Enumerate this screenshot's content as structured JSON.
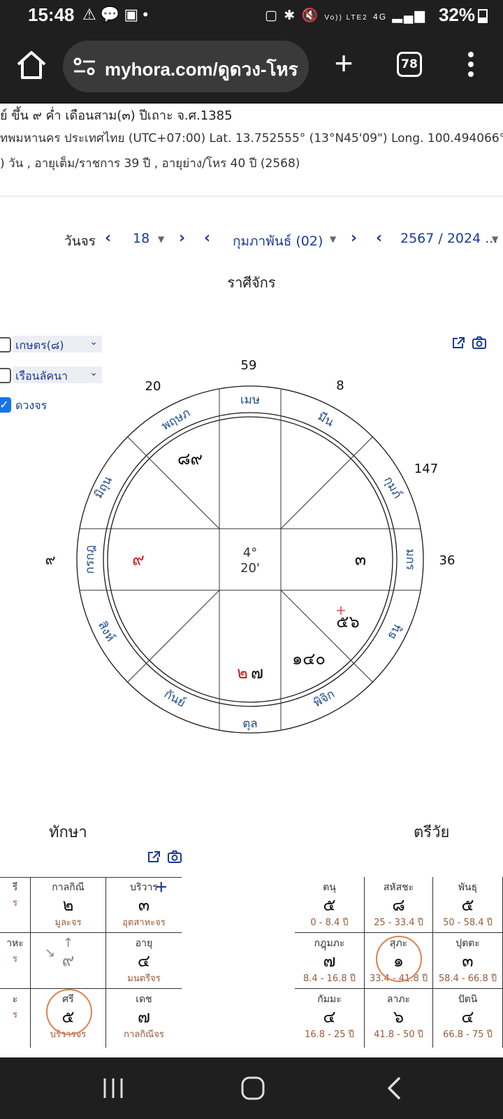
{
  "status_bar": {
    "time": "15:48",
    "left_icons": [
      "warning-icon",
      "line-app-icon",
      "gallery-icon",
      "dot-icon"
    ],
    "right_icons": [
      "nfc-icon",
      "bluetooth-icon",
      "mute-icon",
      "volte-icon",
      "4g-icon",
      "signal-icon"
    ],
    "volte_text": "Vo)) LTE2",
    "net_text": "4G",
    "battery": "32%"
  },
  "browser": {
    "url": "myhora.com/ดูดวง-โหร",
    "tab_count": "78"
  },
  "info": {
    "line1": "ย์ ขึ้น ๙ ค่ำ เดือนสาม(๓) ปีเถาะ จ.ศ.1385",
    "line2": "ทพมหานคร ประเทศไทย (UTC+07:00) Lat. 13.752555° (13°N45'09\") Long. 100.494066° (100°E",
    "line3": ") วัน , อายุเต็ม/ราชการ 39 ปี , อายุย่าง/โหร 40 ปี (2568)"
  },
  "transit_nav": {
    "label": "วันจร",
    "day": "18",
    "month": "กุมภาพันธ์ (02)",
    "year": "2567 / 2024 ..."
  },
  "chart_title": "ราศีจักร",
  "options": {
    "select1": "เกษตร(๘)",
    "select2": "เรือนลัคนา",
    "transit_label": "ดวงจร",
    "transit_checked": true
  },
  "wheel": {
    "center_line1": "4°",
    "center_line2": "20'",
    "signs": [
      "เมษ",
      "พฤษภ",
      "มิถุน",
      "กรกฎ",
      "สิงห์",
      "กันย์",
      "ตุล",
      "พิจิก",
      "ธนู",
      "มกร",
      "กุมภ์",
      "มีน"
    ],
    "outer_numbers": {
      "top": "59",
      "top_left": "20",
      "top_right": "8",
      "right_upper": "147",
      "right": "36",
      "left": "๙"
    },
    "planets": {
      "taurus": "๘๙",
      "cancer": "๙",
      "capricorn": "๓",
      "sagittarius": "๕๖",
      "scorpio": "๑๔๐",
      "libra_red": "๒",
      "libra_black": "๗"
    },
    "colors": {
      "ring": "#1a1a1a",
      "sign_text": "#1e4d8c",
      "red": "#cc2222"
    }
  },
  "taksa": {
    "title": "ทักษา",
    "cells": [
      {
        "top": "รี",
        "mid": "",
        "bot": "ร"
      },
      {
        "top": "กาลกิณี",
        "mid": "๒",
        "bot": "มูละจร"
      },
      {
        "top": "บริวาร",
        "mid": "๓",
        "bot": "อุตสาหะจร"
      },
      {
        "top": "าหะ",
        "mid": "",
        "bot": "ร"
      },
      {
        "top": "",
        "mid": "๙",
        "bot": ""
      },
      {
        "top": "อายุ",
        "mid": "๔",
        "bot": "มนตรีจร"
      },
      {
        "top": "ะ",
        "mid": "",
        "bot": "ร"
      },
      {
        "top": "ศรี",
        "mid": "๕",
        "bot": "บริวารจร"
      },
      {
        "top": "เดช",
        "mid": "๗",
        "bot": "กาลกิณีจร"
      }
    ]
  },
  "triwai": {
    "title": "ตรีวัย",
    "cells": [
      {
        "top": "ตนุ",
        "mid": "๕",
        "bot": "0 - 8.4 ปี"
      },
      {
        "top": "สหัสชะ",
        "mid": "๘",
        "bot": "25 - 33.4 ปี"
      },
      {
        "top": "พันธุ",
        "mid": "๕",
        "bot": "50 - 58.4 ปี"
      },
      {
        "top": "กฎุมภะ",
        "mid": "๗",
        "bot": "8.4 - 16.8 ปี"
      },
      {
        "top": "สุภะ",
        "mid": "๑",
        "bot": "33.4 - 41.8 ปี"
      },
      {
        "top": "ปุตตะ",
        "mid": "๓",
        "bot": "58.4 - 66.8 ปี"
      },
      {
        "top": "กัมมะ",
        "mid": "๔",
        "bot": "16.8 - 25 ปี"
      },
      {
        "top": "ลาภะ",
        "mid": "๖",
        "bot": "41.8 - 50 ปี"
      },
      {
        "top": "ปัตนิ",
        "mid": "๔",
        "bot": "66.8 - 75 ปี"
      }
    ]
  }
}
